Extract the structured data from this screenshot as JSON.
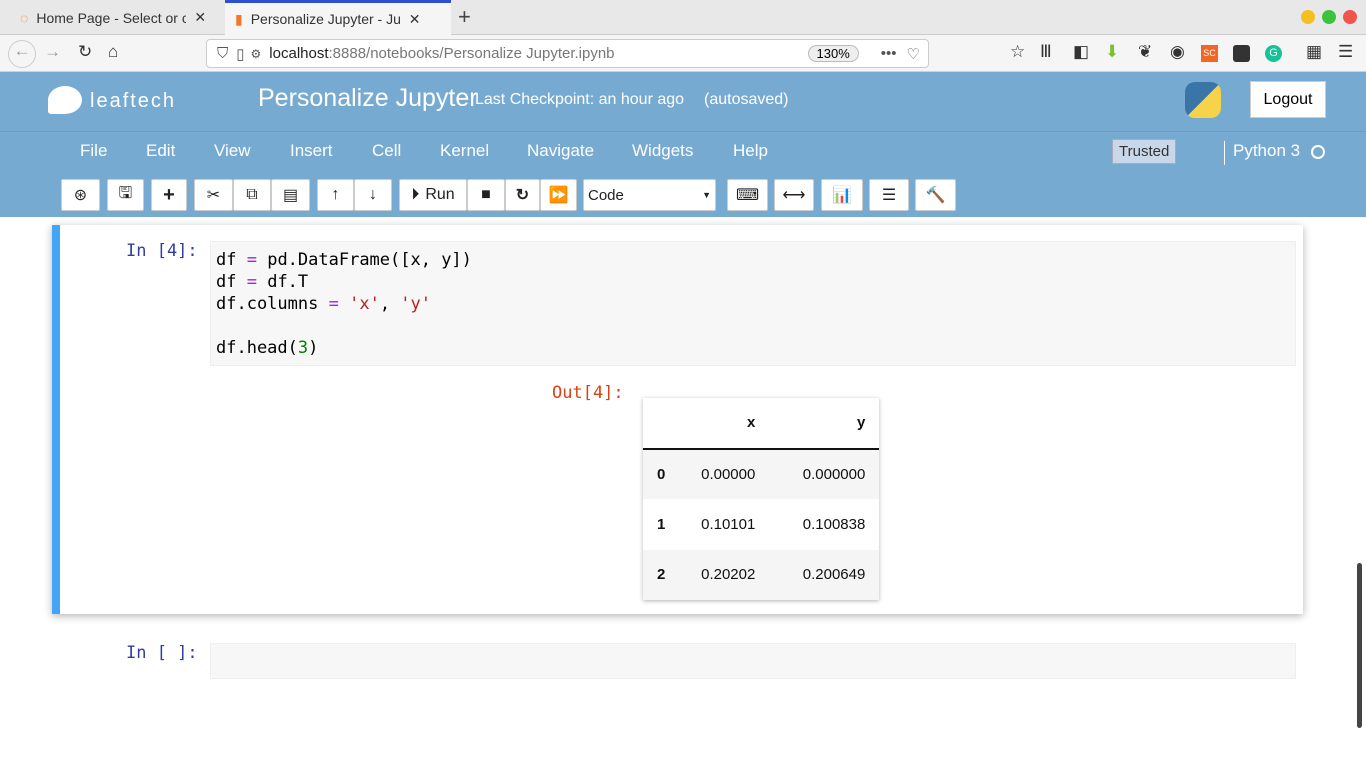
{
  "browser": {
    "tabs": [
      {
        "title": "Home Page - Select or create a notebook"
      },
      {
        "title": "Personalize Jupyter - Jupyter Notebook"
      }
    ],
    "url_host": "localhost",
    "url_path": ":8888/notebooks/Personalize Jupyter.ipynb",
    "zoom": "130%"
  },
  "header": {
    "logo": "leaftech",
    "title": "Personalize Jupyter",
    "checkpoint": "Last Checkpoint: an hour ago",
    "autosave": "(autosaved)",
    "logout": "Logout"
  },
  "menu": {
    "items": [
      "File",
      "Edit",
      "View",
      "Insert",
      "Cell",
      "Kernel",
      "Navigate",
      "Widgets",
      "Help"
    ],
    "trusted": "Trusted",
    "kernel": "Python 3"
  },
  "toolbar": {
    "run": "Run",
    "cell_type": "Code"
  },
  "cells": [
    {
      "prompt": "In [4]:",
      "out_prompt": "Out[4]:",
      "table": {
        "columns": [
          "",
          "x",
          "y"
        ],
        "rows": [
          [
            "0",
            "0.00000",
            "0.000000"
          ],
          [
            "1",
            "0.10101",
            "0.100838"
          ],
          [
            "2",
            "0.20202",
            "0.200649"
          ]
        ]
      }
    },
    {
      "prompt": "In [ ]:"
    }
  ]
}
